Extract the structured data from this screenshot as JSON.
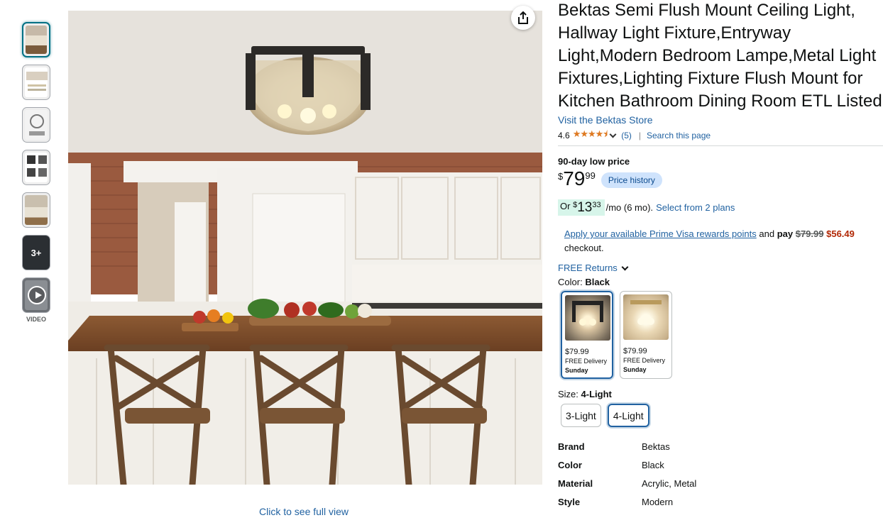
{
  "thumbnails": [
    {
      "name": "thumb-1"
    },
    {
      "name": "thumb-2"
    },
    {
      "name": "thumb-3"
    },
    {
      "name": "thumb-4"
    },
    {
      "name": "thumb-5"
    }
  ],
  "more_label": "3+",
  "video_label": "VIDEO",
  "full_view": "Click to see full view",
  "product": {
    "title": "Bektas Semi Flush Mount Ceiling Light, Hallway Light Fixture,Entryway Light,Modern Bedroom Lampe,Metal Light Fixtures,Lighting Fixture Flush Mount for Kitchen Bathroom Dining Room ETL Listed",
    "store": "Visit the Bektas Store",
    "rating": "4.6",
    "stars": "★★★★⯨",
    "rating_count": "(5)",
    "search_page": "Search this page"
  },
  "price": {
    "low_label": "90-day low price",
    "symbol": "$",
    "whole": "79",
    "fraction": "99",
    "history_btn": "Price history"
  },
  "monthly": {
    "or": "Or",
    "symbol": "$",
    "whole": "13",
    "fraction": "33",
    "term": "/mo (6 mo).",
    "plans": "Select from 2 plans"
  },
  "prime": {
    "link": "Apply your available Prime Visa rewards points",
    "and": "and",
    "pay": "pay",
    "old": "$79.99",
    "new": "$56.49",
    "checkout": "checkout."
  },
  "returns": "FREE Returns",
  "color": {
    "label": "Color:",
    "value": "Black",
    "options": [
      {
        "price": "$79.99",
        "delivery": "FREE Delivery",
        "day": "Sunday"
      },
      {
        "price": "$79.99",
        "delivery": "FREE Delivery",
        "day": "Sunday"
      }
    ]
  },
  "size": {
    "label": "Size:",
    "value": "4-Light",
    "options": [
      "3-Light",
      "4-Light"
    ]
  },
  "specs": [
    {
      "k": "Brand",
      "v": "Bektas"
    },
    {
      "k": "Color",
      "v": "Black"
    },
    {
      "k": "Material",
      "v": "Acrylic, Metal"
    },
    {
      "k": "Style",
      "v": "Modern"
    }
  ],
  "colors": {
    "link": "#2162a1",
    "deal": "#b12704",
    "star": "#de7921",
    "price_history_bg": "#cfe3fc"
  }
}
